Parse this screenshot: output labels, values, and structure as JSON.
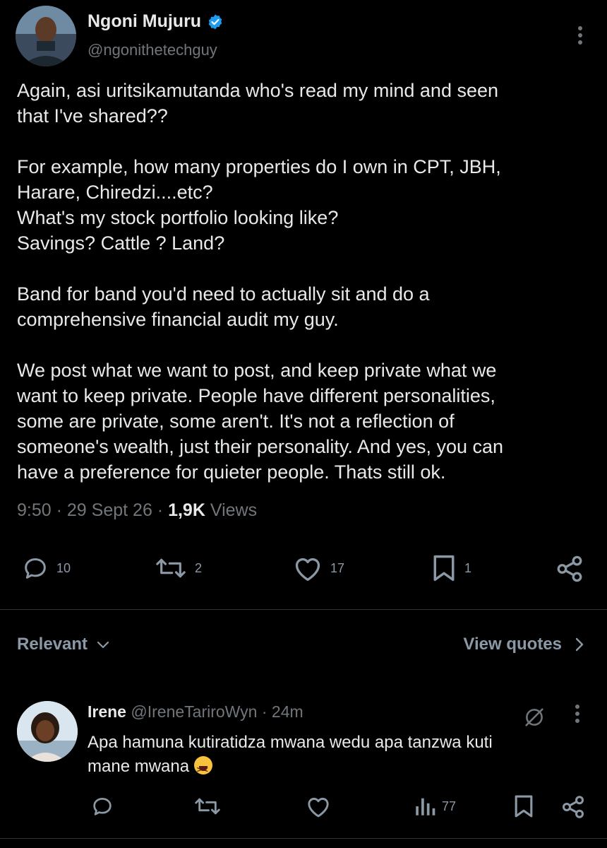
{
  "tweet": {
    "author_name": "Ngoni Mujuru",
    "handle": "@ngonithetechguy",
    "paragraphs": [
      [
        "Again, asi uritsikamutanda who's read my mind and seen",
        "that I've shared??"
      ],
      [
        "For example, how many properties do I own in CPT, JBH,",
        "Harare, Chiredzi....etc?",
        "What's my stock portfolio looking like?",
        "Savings? Cattle ? Land?"
      ],
      [
        "Band for band you'd need to actually sit and do a",
        "comprehensive financial audit my guy."
      ],
      [
        "We post what we want to post, and keep private what we",
        "want to keep private. People have different personalities,",
        "some are private, some aren't. It's not a reflection of",
        "someone's wealth, just their personality. And yes, you can",
        "have a preference for quieter people. Thats still ok."
      ]
    ],
    "time": "9:50",
    "date": "29 Sept 26",
    "views_count": "1,9K",
    "views_label": "Views",
    "replies": "10",
    "reposts": "2",
    "likes": "17",
    "bookmarks": "1"
  },
  "sort": {
    "label": "Relevant",
    "view_quotes": "View quotes"
  },
  "reply": {
    "name": "Irene",
    "handle": "@IreneTariroWyn",
    "time": "24m",
    "text_line1": "Apa hamuna kutiratidza mwana wedu apa tanzwa kuti",
    "text_line2": "mane mwana",
    "views": "77"
  },
  "icons": {
    "verified": "verified-badge-icon",
    "more": "more-vertical-icon",
    "reply": "reply-icon",
    "repost": "repost-icon",
    "like": "heart-icon",
    "bookmark": "bookmark-icon",
    "share": "share-icon",
    "chevron_down": "chevron-down-icon",
    "chevron_right": "chevron-right-icon",
    "grok": "grok-icon",
    "analytics": "analytics-icon",
    "emoji": "laughing-face-emoji"
  },
  "colors": {
    "background": "#000000",
    "text": "#e7e9ea",
    "muted": "#71767b",
    "verified": "#1d9bf0",
    "divider": "#2f3336"
  }
}
